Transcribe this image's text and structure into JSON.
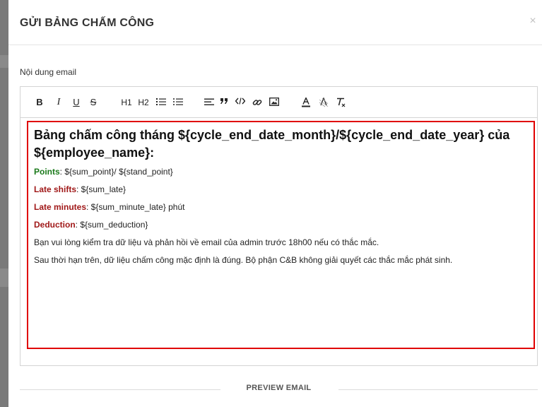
{
  "modal": {
    "title": "GỬI BẢNG CHẤM CÔNG",
    "close_icon": "×"
  },
  "field": {
    "label": "Nội dung email"
  },
  "toolbar": {
    "bold": "B",
    "italic": "I",
    "underline": "U",
    "strike": "S",
    "h1": "H1",
    "h2": "H2"
  },
  "email": {
    "heading": "Bảng chấm công tháng ${cycle_end_date_month}/${cycle_end_date_year} của ${employee_name}:",
    "points_label": "Points",
    "points_value": ": ${sum_point}/ ${stand_point}",
    "late_shifts_label": "Late shifts",
    "late_shifts_value": ": ${sum_late}",
    "late_minutes_label": "Late minutes",
    "late_minutes_value": ": ${sum_minute_late} phút",
    "deduction_label": "Deduction",
    "deduction_value": ": ${sum_deduction}",
    "paragraph1": "Bạn vui lòng kiểm tra dữ liệu và phản hồi về email của admin trước 18h00 nếu có thắc mắc.",
    "paragraph2": "Sau thời hạn trên, dữ liệu chấm công mặc định là đúng. Bộ phận C&B không giải quyết các thắc mắc phát sinh."
  },
  "preview": {
    "label": "PREVIEW EMAIL"
  },
  "colors": {
    "highlight_border": "#e00000",
    "label_green": "#1b7a1b",
    "label_red": "#a01818"
  }
}
